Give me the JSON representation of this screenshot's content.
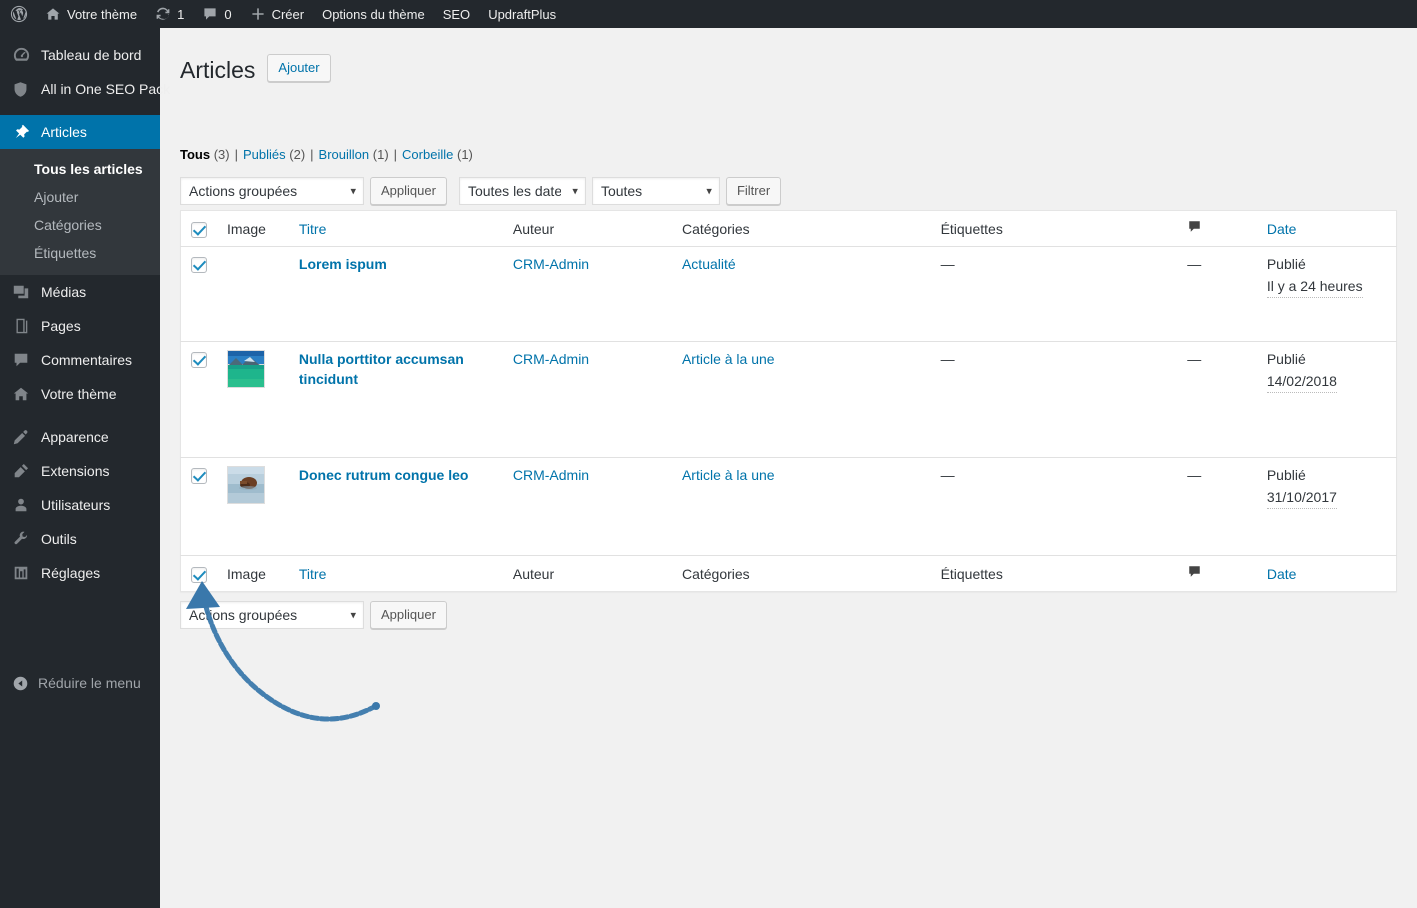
{
  "adminbar": {
    "wp_logo": "wordpress-logo-icon",
    "items": [
      {
        "icon": "home-icon",
        "label": "Votre thème"
      },
      {
        "icon": "updates-icon",
        "label": "1"
      },
      {
        "icon": "comment-icon",
        "label": "0"
      },
      {
        "icon": "plus-icon",
        "label": "Créer"
      },
      {
        "icon": "",
        "label": "Options du thème"
      },
      {
        "icon": "",
        "label": "SEO"
      },
      {
        "icon": "",
        "label": "UpdraftPlus"
      }
    ]
  },
  "sidebar": {
    "items": [
      {
        "icon": "dashboard-icon",
        "label": "Tableau de bord",
        "current": false
      },
      {
        "icon": "shield-icon",
        "label": "All in One SEO Pack",
        "current": false
      },
      {
        "icon": "pin-icon",
        "label": "Articles",
        "current": true
      },
      {
        "icon": "media-icon",
        "label": "Médias",
        "current": false
      },
      {
        "icon": "pages-icon",
        "label": "Pages",
        "current": false
      },
      {
        "icon": "comments-icon",
        "label": "Commentaires",
        "current": false
      },
      {
        "icon": "home-icon",
        "label": "Votre thème",
        "current": false
      },
      {
        "icon": "appearance-icon",
        "label": "Apparence",
        "current": false
      },
      {
        "icon": "plugins-icon",
        "label": "Extensions",
        "current": false
      },
      {
        "icon": "users-icon",
        "label": "Utilisateurs",
        "current": false
      },
      {
        "icon": "tools-icon",
        "label": "Outils",
        "current": false
      },
      {
        "icon": "settings-icon",
        "label": "Réglages",
        "current": false
      }
    ],
    "submenu": [
      {
        "label": "Tous les articles",
        "current": true
      },
      {
        "label": "Ajouter",
        "current": false
      },
      {
        "label": "Catégories",
        "current": false
      },
      {
        "label": "Étiquettes",
        "current": false
      }
    ],
    "collapse": {
      "icon": "collapse-arrow-icon",
      "label": "Réduire le menu"
    }
  },
  "page": {
    "title": "Articles",
    "add_button": "Ajouter"
  },
  "views": [
    {
      "label": "Tous",
      "count": "(3)",
      "current": true
    },
    {
      "label": "Publiés",
      "count": "(2)",
      "current": false
    },
    {
      "label": "Brouillon",
      "count": "(1)",
      "current": false
    },
    {
      "label": "Corbeille",
      "count": "(1)",
      "current": false
    }
  ],
  "tablenav_top": {
    "bulk_action": "Actions groupées",
    "apply": "Appliquer",
    "date_filter": "Toutes les dates",
    "category_filter": "Toutes",
    "filter": "Filtrer"
  },
  "tablenav_bottom": {
    "bulk_action": "Actions groupées",
    "apply": "Appliquer"
  },
  "table": {
    "columns": {
      "image": "Image",
      "title": "Titre",
      "author": "Auteur",
      "categories": "Catégories",
      "tags": "Étiquettes",
      "comments": "comment-bubble-icon",
      "date": "Date"
    },
    "rows": [
      {
        "checked": true,
        "has_thumb": false,
        "title": "Lorem ispum",
        "author": "CRM-Admin",
        "categories": "Actualité",
        "tags": "—",
        "comments": "—",
        "date_status": "Publié",
        "date_value": "Il y a 24 heures"
      },
      {
        "checked": true,
        "has_thumb": true,
        "thumb": "beach-mountain-thumbnail",
        "title": "Nulla porttitor accumsan tincidunt",
        "author": "CRM-Admin",
        "categories": "Article à la une",
        "tags": "—",
        "comments": "—",
        "date_status": "Publié",
        "date_value": "14/02/2018"
      },
      {
        "checked": true,
        "has_thumb": true,
        "thumb": "boat-water-thumbnail",
        "title": "Donec rutrum congue leo",
        "author": "CRM-Admin",
        "categories": "Article à la une",
        "tags": "—",
        "comments": "—",
        "date_status": "Publié",
        "date_value": "31/10/2017"
      }
    ]
  },
  "annotation": {
    "type": "curved-arrow",
    "color": "#3a78ab",
    "points_to": "select-all-checkbox-bottom"
  },
  "colors": {
    "sidebar_bg": "#23282d",
    "submenu_bg": "#32373c",
    "accent": "#0073aa",
    "link": "#0073aa",
    "page_bg": "#f1f1f1",
    "table_bg": "#ffffff"
  }
}
